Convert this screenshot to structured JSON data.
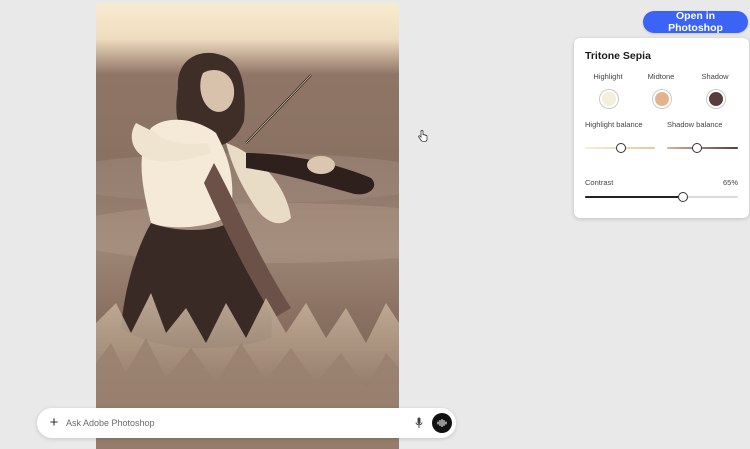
{
  "header": {
    "open_button_label": "Open in Photoshop"
  },
  "panel": {
    "title": "Tritone Sepia",
    "swatches": [
      {
        "label": "Highlight",
        "color": "#f3efd8"
      },
      {
        "label": "Midtone",
        "color": "#e2b48e"
      },
      {
        "label": "Shadow",
        "color": "#5b3c3d"
      }
    ],
    "highlight_balance": {
      "label": "Highlight balance",
      "value": 0.5
    },
    "shadow_balance": {
      "label": "Shadow balance",
      "value": 0.4
    },
    "contrast": {
      "label": "Contrast",
      "value_text": "65%",
      "value": 0.65
    }
  },
  "prompt": {
    "placeholder": "Ask Adobe Photoshop",
    "add_icon": "plus-icon",
    "mic_icon": "microphone-icon",
    "voice_icon": "voice-wave-icon"
  },
  "colors": {
    "accent": "#3b63f5",
    "sepia_light": "#f5ecd2",
    "sepia_dark": "#4e3a33"
  }
}
